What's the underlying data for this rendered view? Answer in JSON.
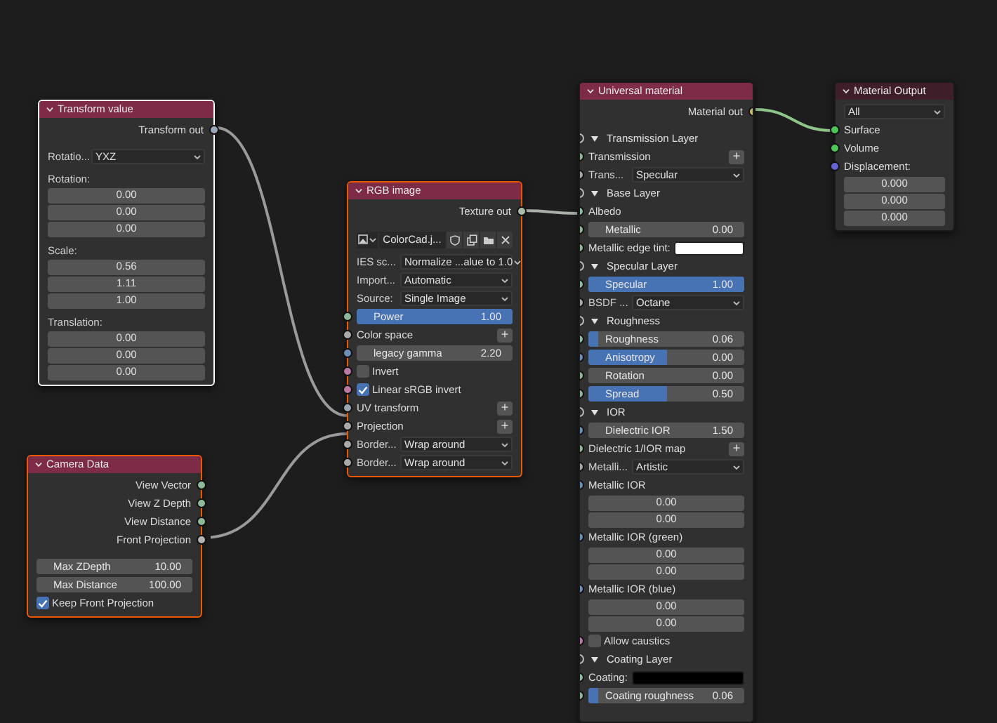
{
  "nodes": [
    {
      "title": "Transform value",
      "color": "#7d2b46",
      "selected": true,
      "active": true,
      "rows": [
        {
          "kind": "output",
          "label": "Transform out",
          "color": "#9aa6b4"
        },
        {
          "kind": "dropdown",
          "label": "Rotatio...",
          "value": "YXZ"
        },
        {
          "kind": "heading",
          "label": "Rotation:"
        },
        {
          "kind": "number",
          "value": "0.00"
        },
        {
          "kind": "number",
          "value": "0.00"
        },
        {
          "kind": "number",
          "value": "0.00"
        },
        {
          "kind": "heading",
          "label": "Scale:"
        },
        {
          "kind": "number",
          "value": "0.56"
        },
        {
          "kind": "number",
          "value": "1.11"
        },
        {
          "kind": "number",
          "value": "1.00"
        },
        {
          "kind": "heading",
          "label": "Translation:"
        },
        {
          "kind": "number",
          "value": "0.00"
        },
        {
          "kind": "number",
          "value": "0.00"
        },
        {
          "kind": "number",
          "value": "0.00"
        }
      ]
    },
    {
      "title": "RGB image",
      "color": "#7d2b46",
      "selected": true,
      "active": false,
      "rows": [
        {
          "kind": "output",
          "label": "Texture out",
          "color": "#a8bca8"
        },
        {
          "kind": "image",
          "value": "ColorCad.j..."
        },
        {
          "kind": "dropdown",
          "label": "IES sc...",
          "value": "Normalize ...alue to 1.0"
        },
        {
          "kind": "dropdown",
          "label": "Import...",
          "value": "Automatic"
        },
        {
          "kind": "dropdown",
          "label": "Source:",
          "value": "Single Image"
        },
        {
          "kind": "slider",
          "label": "Power",
          "value": "1.00",
          "level": 1,
          "color": "#8fb89a"
        },
        {
          "kind": "socket",
          "label": "Color space",
          "plus": "+",
          "color": "#a9a9a9"
        },
        {
          "kind": "slider",
          "label": "legacy gamma",
          "value": "2.20",
          "level": 0,
          "color": "#6e8fb5"
        },
        {
          "kind": "checkbox",
          "label": "Invert",
          "checked": false,
          "color": "#b87aa0"
        },
        {
          "kind": "checkbox",
          "label": "Linear sRGB invert",
          "checked": true,
          "color": "#b87aa0"
        },
        {
          "kind": "socket",
          "label": "UV transform",
          "plus": "+",
          "color": "#9aa6b4"
        },
        {
          "kind": "socket",
          "label": "Projection",
          "plus": "+",
          "color": "#a9a9a9"
        },
        {
          "kind": "dropdown",
          "label": "Border...",
          "value": "Wrap around",
          "color": "#a9a9a9"
        },
        {
          "kind": "dropdown",
          "label": "Border...",
          "value": "Wrap around",
          "color": "#a9a9a9"
        }
      ]
    },
    {
      "title": "Camera Data",
      "color": "#7d2b46",
      "selected": true,
      "active": false,
      "rows": [
        {
          "kind": "output",
          "label": "View Vector",
          "color": "#8fb89a"
        },
        {
          "kind": "output",
          "label": "View Z Depth",
          "color": "#8fb89a"
        },
        {
          "kind": "output",
          "label": "View Distance",
          "color": "#8fb89a"
        },
        {
          "kind": "output",
          "label": "Front Projection",
          "color": "#b4b4b4"
        },
        {
          "kind": "slider",
          "label": "Max ZDepth",
          "value": "10.00",
          "level": 0
        },
        {
          "kind": "slider",
          "label": "Max Distance",
          "value": "100.00",
          "level": 0
        },
        {
          "kind": "checkbox",
          "label": "Keep Front Projection",
          "checked": true
        }
      ]
    },
    {
      "title": "Universal material",
      "color": "#7d2b46",
      "selected": false,
      "active": false,
      "rows": [
        {
          "kind": "output",
          "label": "Material out",
          "color": "#c8c070"
        },
        {
          "kind": "panel",
          "label": "Transmission Layer"
        },
        {
          "kind": "socket",
          "label": "Transmission",
          "plus": "+",
          "color": "#8fb89a"
        },
        {
          "kind": "dropdown",
          "label": "Trans...",
          "value": "Specular",
          "color": "#a9a9a9"
        },
        {
          "kind": "panel",
          "label": "Base Layer"
        },
        {
          "kind": "socket",
          "label": "Albedo",
          "color": "#8fb89a"
        },
        {
          "kind": "slider",
          "label": "Metallic",
          "value": "0.00",
          "level": 0,
          "color": "#8fb89a"
        },
        {
          "kind": "swatch",
          "label": "Metallic edge tint:",
          "color": "#ffffff",
          "socket": {
            "color": "#8fb89a"
          }
        },
        {
          "kind": "panel",
          "label": "Specular Layer"
        },
        {
          "kind": "slider",
          "label": "Specular",
          "value": "1.00",
          "level": 1,
          "color": "#8fb89a"
        },
        {
          "kind": "dropdown",
          "label": "BSDF ...",
          "value": "Octane",
          "color": "#a9a9a9"
        },
        {
          "kind": "panel",
          "label": "Roughness"
        },
        {
          "kind": "slider",
          "label": "Roughness",
          "value": "0.06",
          "level": 0.06,
          "color": "#8fb89a"
        },
        {
          "kind": "slider",
          "label": "Anisotropy",
          "value": "0.00",
          "level": 0.5,
          "color": "#6e8fb5"
        },
        {
          "kind": "slider",
          "label": "Rotation",
          "value": "0.00",
          "level": 0,
          "color": "#8fb89a"
        },
        {
          "kind": "slider",
          "label": "Spread",
          "value": "0.50",
          "level": 0.5,
          "color": "#8fb89a"
        },
        {
          "kind": "panel",
          "label": "IOR"
        },
        {
          "kind": "slider",
          "label": "Dielectric IOR",
          "value": "1.50",
          "level": 0,
          "color": "#6e8fb5"
        },
        {
          "kind": "socket",
          "label": "Dielectric 1/IOR map",
          "plus": "+",
          "color": "#8fb89a"
        },
        {
          "kind": "dropdown",
          "label": "Metalli...",
          "value": "Artistic",
          "color": "#a9a9a9"
        },
        {
          "kind": "socket",
          "label": "Metallic IOR",
          "color": "#6e8fb5"
        },
        {
          "kind": "number",
          "value": "0.00"
        },
        {
          "kind": "number",
          "value": "0.00"
        },
        {
          "kind": "socket",
          "label": "Metallic IOR (green)",
          "color": "#6e8fb5"
        },
        {
          "kind": "number",
          "value": "0.00"
        },
        {
          "kind": "number",
          "value": "0.00"
        },
        {
          "kind": "socket",
          "label": "Metallic IOR (blue)",
          "color": "#6e8fb5"
        },
        {
          "kind": "number",
          "value": "0.00"
        },
        {
          "kind": "number",
          "value": "0.00"
        },
        {
          "kind": "checkbox",
          "label": "Allow caustics",
          "checked": false,
          "color": "#b87aa0"
        },
        {
          "kind": "panel",
          "label": "Coating Layer"
        },
        {
          "kind": "swatch",
          "label": "Coating:",
          "color": "#000000",
          "socket": {
            "color": "#8fb89a"
          }
        },
        {
          "kind": "slider",
          "label": "Coating roughness",
          "value": "0.06",
          "level": 0.06,
          "color": "#8fb89a"
        }
      ]
    },
    {
      "title": "Material Output",
      "color": "#3e1e28",
      "selected": false,
      "active": false,
      "rows": [
        {
          "kind": "select",
          "value": "All"
        },
        {
          "kind": "socket",
          "label": "Surface",
          "color": "#4fc45a"
        },
        {
          "kind": "socket",
          "label": "Volume",
          "color": "#4fc45a"
        },
        {
          "kind": "socket",
          "label": "Displacement:",
          "color": "#6464d2"
        },
        {
          "kind": "number",
          "value": "0.000"
        },
        {
          "kind": "number",
          "value": "0.000"
        },
        {
          "kind": "number",
          "value": "0.000"
        }
      ]
    }
  ]
}
